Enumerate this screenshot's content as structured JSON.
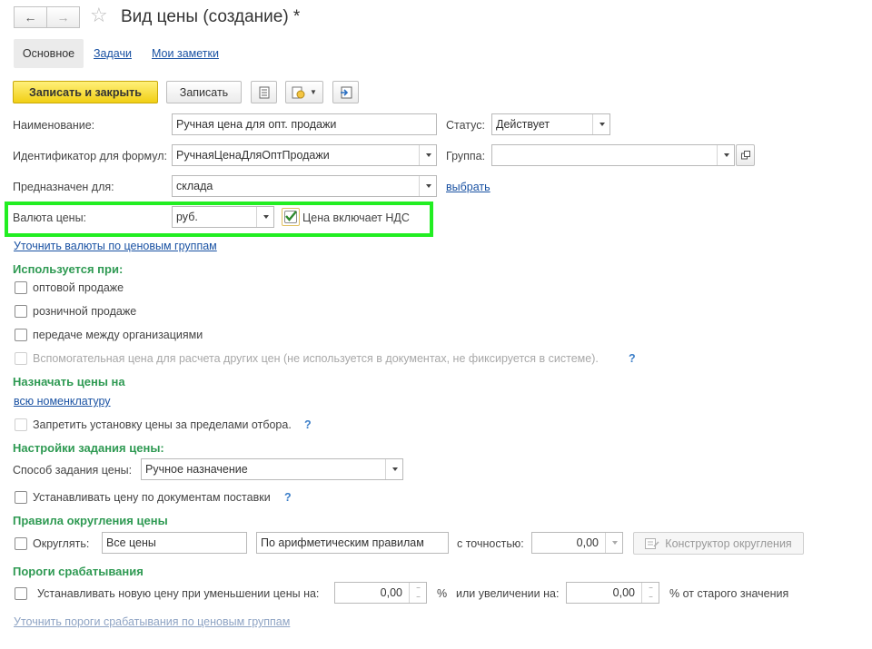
{
  "window": {
    "title": "Вид цены (создание) *"
  },
  "tabs": [
    {
      "label": "Основное"
    },
    {
      "label": "Задачи"
    },
    {
      "label": "Мои заметки"
    }
  ],
  "toolbar": {
    "save_close_label": "Записать и закрыть",
    "save_label": "Записать"
  },
  "form": {
    "name_label": "Наименование:",
    "name_value": "Ручная цена для опт. продажи",
    "status_label": "Статус:",
    "status_value": "Действует",
    "formula_id_label": "Идентификатор для формул:",
    "formula_id_value": "РучнаяЦенаДляОптПродажи",
    "group_label": "Группа:",
    "group_value": "",
    "purpose_label": "Предназначен для:",
    "purpose_value": "склада",
    "select_link": "выбрать",
    "currency_label": "Валюта цены:",
    "currency_value": "руб.",
    "vat_label": "Цена включает НДС",
    "vat_checked": true,
    "refine_currency_link": "Уточнить валюты по ценовым группам"
  },
  "used_in": {
    "title": "Используется при:",
    "items": [
      {
        "label": "оптовой продаже",
        "checked": false,
        "disabled": false
      },
      {
        "label": "розничной продаже",
        "checked": false,
        "disabled": false
      },
      {
        "label": "передаче между организациями",
        "checked": false,
        "disabled": false
      },
      {
        "label": "Вспомогательная цена для расчета других цен (не используется в документах, не фиксируется в системе).",
        "checked": false,
        "disabled": true
      }
    ],
    "help": "?"
  },
  "assign": {
    "title": "Назначать цены на",
    "link": "всю номенклатуру",
    "forbid_label": "Запретить установку цены за пределами отбора.",
    "help": "?"
  },
  "settings": {
    "title": "Настройки задания цены:",
    "method_label": "Способ задания цены:",
    "method_value": "Ручное назначение",
    "docs_label": "Устанавливать цену по документам поставки",
    "help": "?"
  },
  "rounding": {
    "title": "Правила округления цены",
    "round_label": "Округлять:",
    "scope_value": "Все цены",
    "rule_value": "По арифметическим правилам",
    "precision_label": "с точностью:",
    "precision_value": "0,00",
    "constructor_label": "Конструктор округления"
  },
  "thresholds": {
    "title": "Пороги срабатывания",
    "decrease_label": "Устанавливать новую цену при уменьшении цены на:",
    "decrease_value": "0,00",
    "percent_sign": "%",
    "increase_label": "или увеличении на:",
    "increase_value": "0,00",
    "old_value_label": "% от старого значения",
    "refine_link": "Уточнить пороги срабатывания по ценовым группам"
  },
  "colors": {
    "section_green": "#2f9a53",
    "link_blue": "#1a52a3",
    "primary_yellow": "#f1cf15",
    "highlight_green": "#22ee22"
  }
}
